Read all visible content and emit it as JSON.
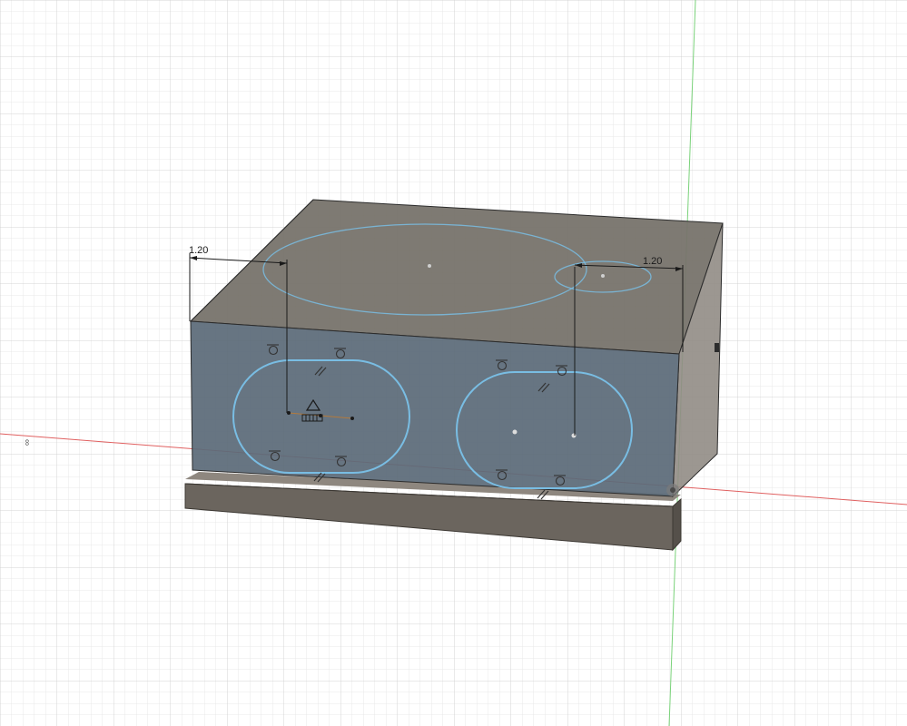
{
  "canvas": {
    "view": "3d-sketch-viewport",
    "colors": {
      "background": "#ffffff",
      "grid_minor": "#e6e6e6",
      "grid_major": "#cfcfcf",
      "x_axis": "#e06060",
      "y_axis": "#7ad27a",
      "body_top": "#77736b",
      "body_front": "#5d6d79",
      "body_side": "#8c8780",
      "base_plate": "#6b655e",
      "sketch_curve": "#79bde3",
      "dimension_line": "#1a1a1a",
      "constraint_glyph": "#3a3a3a"
    }
  },
  "dimensions": [
    {
      "id": "dim-left",
      "value": "1.20"
    },
    {
      "id": "dim-right",
      "value": "1.20"
    }
  ],
  "axis_marker": {
    "text": "∞"
  },
  "icons": {
    "constraint": "tangent-constraint-icon",
    "parallel": "parallel-constraint-icon",
    "fix": "fix-constraint-icon",
    "origin": "origin-icon"
  }
}
